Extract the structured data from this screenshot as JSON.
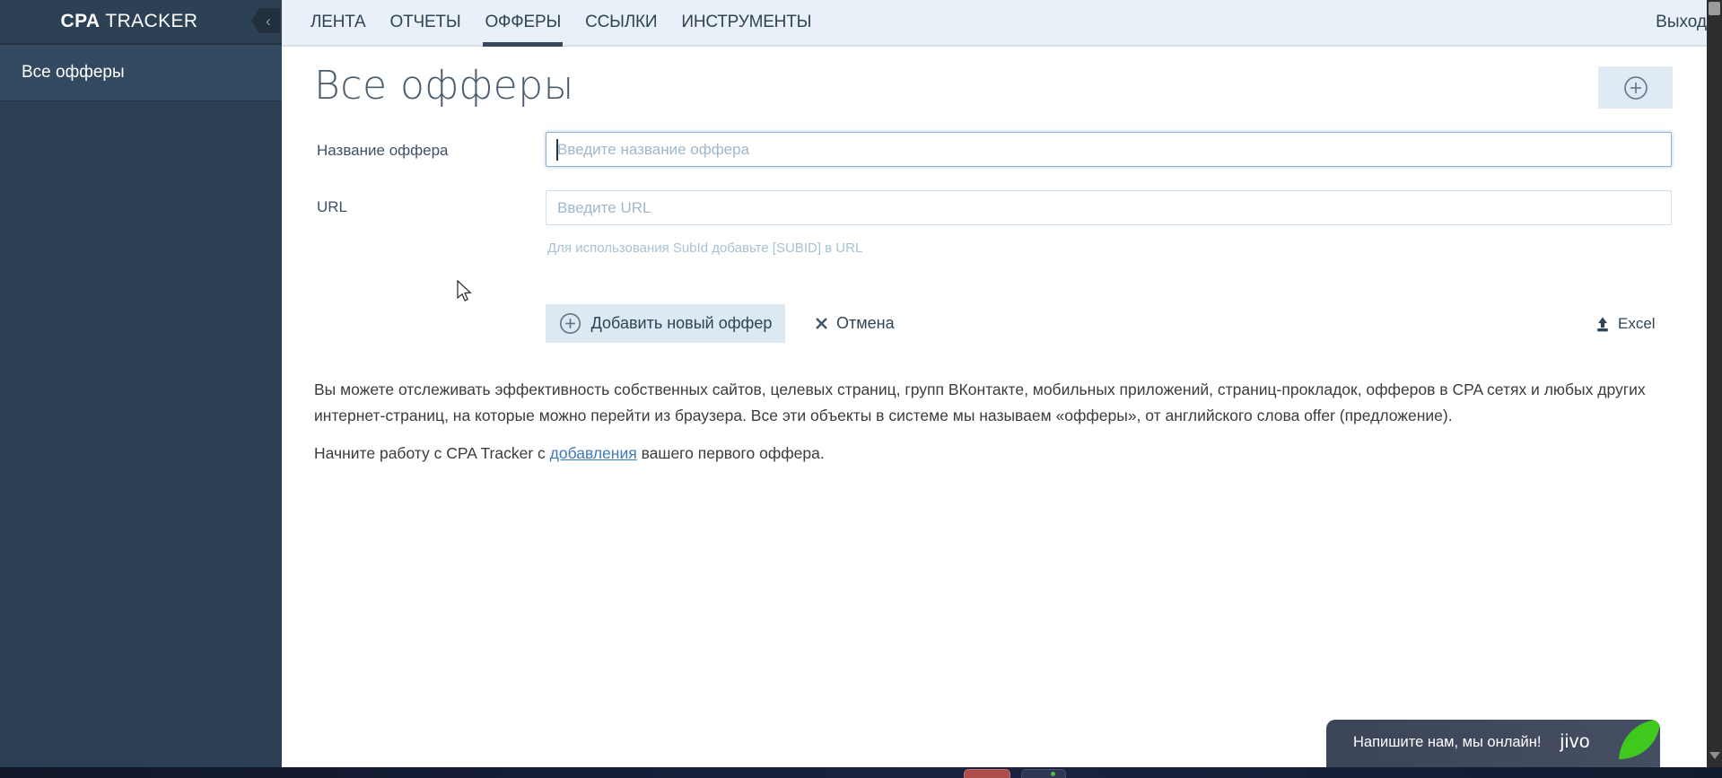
{
  "app": {
    "brand_bold": "CPA",
    "brand_rest": " TRACKER"
  },
  "sidebar": {
    "active_item": "Все офферы"
  },
  "nav": {
    "tabs": [
      "ЛЕНТА",
      "ОТЧЕТЫ",
      "ОФФЕРЫ",
      "ССЫЛКИ",
      "ИНСТРУМЕНТЫ"
    ],
    "active_tab": "ОФФЕРЫ",
    "logout_label": "Выход"
  },
  "page": {
    "title": "Все офферы"
  },
  "form": {
    "name_label": "Название оффера",
    "name_placeholder": "Введите название оффера",
    "name_value": "",
    "url_label": "URL",
    "url_placeholder": "Введите URL",
    "url_value": "",
    "url_hint": "Для использования SubId добавьте [SUBID] в URL",
    "submit_label": "Добавить новый оффер",
    "cancel_label": "Отмена",
    "excel_label": "Excel"
  },
  "content": {
    "paragraph1": "Вы можете отслеживать эффективность собственных сайтов, целевых страниц, групп ВКонтакте, мобильных приложений, страниц-прокладок, офферов в CPA сетях и любых других интернет-страниц, на которые можно перейти из браузера. Все эти объекты в системе мы называем «офферы», от английского слова offer (предложение).",
    "paragraph2_before": "Начните работу с CPA Tracker с ",
    "paragraph2_link": "добавления",
    "paragraph2_after": " вашего первого оффера."
  },
  "chat": {
    "message": "Напишите нам, мы онлайн!",
    "brand": "jivo"
  },
  "colors": {
    "sidebar_bg": "#2c3f52",
    "sidebar_active_bg": "#32495f",
    "nav_bg": "#e9f0f7",
    "nav_text": "#2e4456",
    "accent_button_bg": "#dce8f2",
    "focus_border": "#8db4d8",
    "link": "#3e7ab9",
    "jivo_green": "#3fc81e",
    "chat_bg": "#404a5e"
  }
}
